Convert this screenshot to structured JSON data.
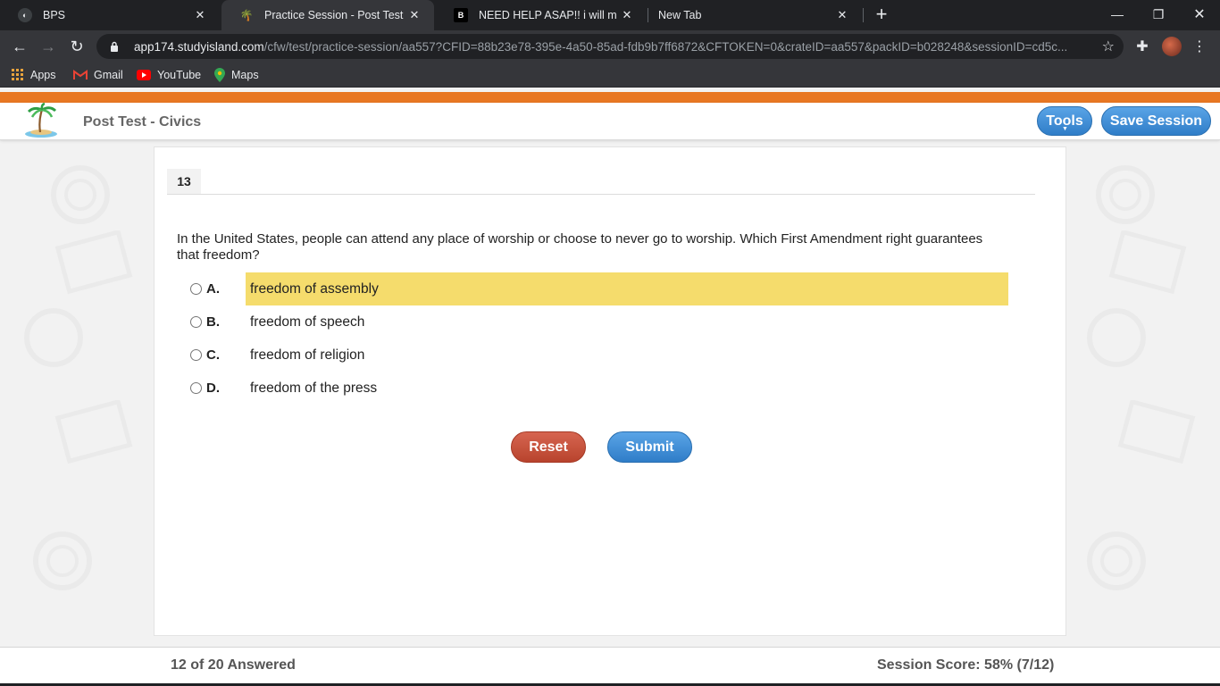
{
  "browser": {
    "tabs": [
      {
        "title": "BPS",
        "active": false
      },
      {
        "title": "Practice Session - Post Test - Civics",
        "active": true
      },
      {
        "title": "NEED HELP ASAP!! i will mark brainliest",
        "active": false
      },
      {
        "title": "New Tab",
        "active": false
      }
    ],
    "url_host": "app174.studyisland.com",
    "url_path": "/cfw/test/practice-session/aa557?CFID=88b23e78-395e-4a50-85ad-fdb9b7ff6872&CFTOKEN=0&crateID=aa557&packID=b028248&sessionID=cd5c...",
    "bookmarks": [
      {
        "label": "Apps",
        "icon": "apps-grid-icon"
      },
      {
        "label": "Gmail",
        "icon": "gmail-icon"
      },
      {
        "label": "YouTube",
        "icon": "youtube-icon"
      },
      {
        "label": "Maps",
        "icon": "maps-icon"
      }
    ]
  },
  "app": {
    "title": "Post Test - Civics",
    "tools_label": "Tools",
    "save_label": "Save Session",
    "accent": "#2f7dc8",
    "brand_strip": "#e87722"
  },
  "question": {
    "number": "13",
    "text": "In the United States, people can attend any place of worship or choose to never go to worship. Which First Amendment right guarantees that freedom?",
    "choices": [
      {
        "letter": "A.",
        "text": "freedom of assembly",
        "highlighted": true
      },
      {
        "letter": "B.",
        "text": "freedom of speech",
        "highlighted": false
      },
      {
        "letter": "C.",
        "text": "freedom of religion",
        "highlighted": false
      },
      {
        "letter": "D.",
        "text": "freedom of the press",
        "highlighted": false
      }
    ],
    "reset_label": "Reset",
    "submit_label": "Submit"
  },
  "footer": {
    "progress": "12 of 20 Answered",
    "score": "Session Score: 58% (7/12)"
  }
}
